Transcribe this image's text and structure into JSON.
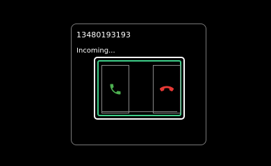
{
  "call": {
    "number": "13480193193",
    "status": "Incoming..."
  },
  "buttons": {
    "accept": {
      "icon": "phone-accept-icon",
      "color": "#4caf50"
    },
    "decline": {
      "icon": "phone-hangup-icon",
      "color": "#e53935"
    }
  },
  "colors": {
    "background": "#000000",
    "card_border": "#7a7a7a",
    "focus_ring": "#3fd08a",
    "text": "#ffffff"
  }
}
